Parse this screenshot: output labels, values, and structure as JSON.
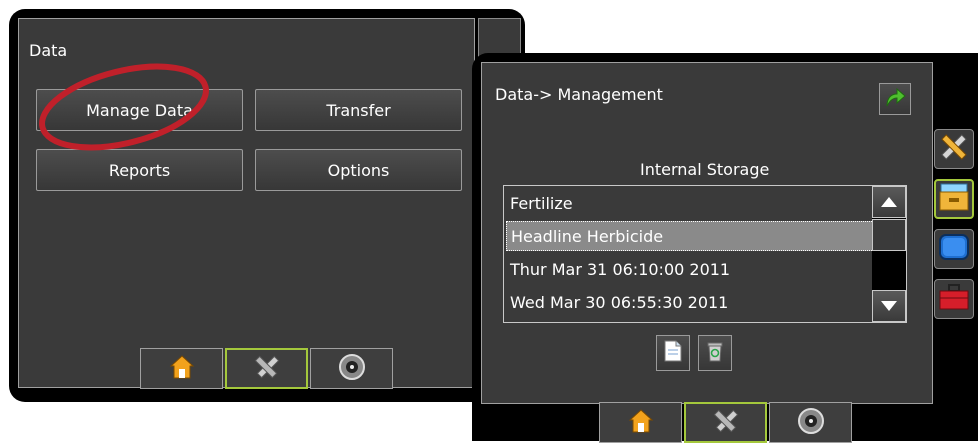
{
  "data_window": {
    "title": "Data",
    "buttons": {
      "manage_data": "Manage Data",
      "transfer": "Transfer",
      "reports": "Reports",
      "options": "Options"
    }
  },
  "management_window": {
    "title": "Data-> Management",
    "storage_title": "Internal Storage",
    "items": [
      "Fertilize",
      "Headline Herbicide",
      "Thur Mar 31 06:10:00 2011",
      "Wed Mar 30 06:55:30 2011"
    ],
    "selected_index": 1
  },
  "bottom_tabs": [
    {
      "icon": "home-icon"
    },
    {
      "icon": "tools-icon",
      "active": true
    },
    {
      "icon": "gauge-icon"
    }
  ],
  "side_icons": [
    {
      "icon": "tools-icon"
    },
    {
      "icon": "folder-icon",
      "active": true
    },
    {
      "icon": "display-icon"
    },
    {
      "icon": "toolbox-icon"
    }
  ],
  "colors": {
    "active_border": "#a4c83c",
    "highlight_circle": "#c0202a",
    "forward_arrow": "#4fbf2f"
  }
}
